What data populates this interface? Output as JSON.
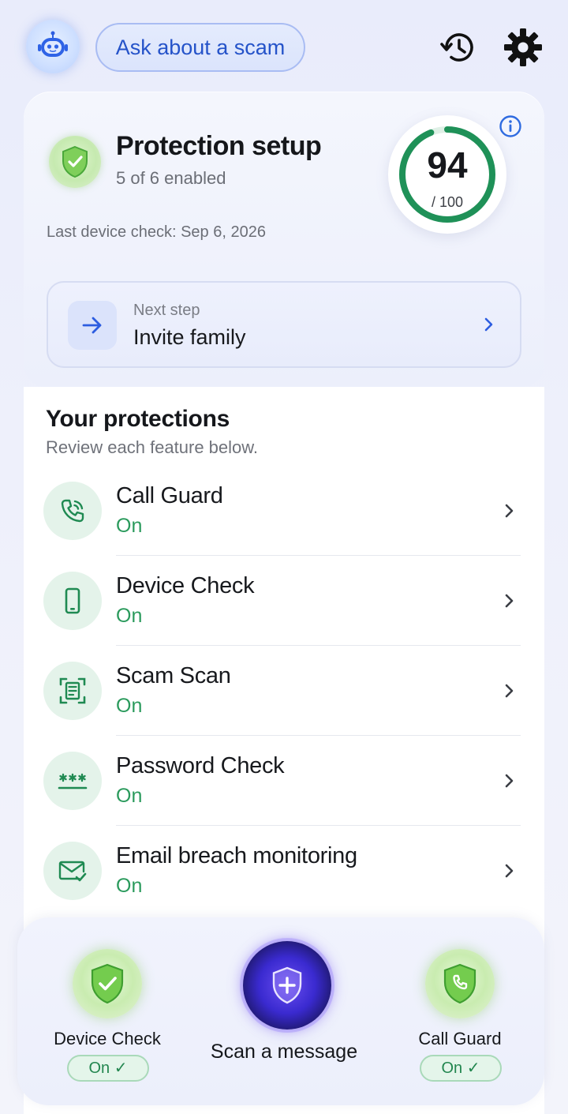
{
  "topbar": {
    "ask_label": "Ask about a scam",
    "avatar_icon": "assistant-bot-icon",
    "history_icon": "history-icon",
    "settings_icon": "gear-icon"
  },
  "setup": {
    "title": "Protection setup",
    "subtitle": "5 of 6 enabled",
    "last_check": "Last device check: Sep 6, 2026",
    "score": "94",
    "score_max": "/ 100",
    "score_fraction": 0.94,
    "next_step_label": "Next step",
    "next_step_value": "Invite family"
  },
  "protections": {
    "title": "Your protections",
    "subtitle": "Review each feature below.",
    "items": [
      {
        "name": "Call Guard",
        "status": "On",
        "icon": "phone-call-icon"
      },
      {
        "name": "Device Check",
        "status": "On",
        "icon": "smartphone-icon"
      },
      {
        "name": "Scam Scan",
        "status": "On",
        "icon": "scan-document-icon"
      },
      {
        "name": "Password Check",
        "status": "On",
        "icon": "password-icon"
      },
      {
        "name": "Email breach monitoring",
        "status": "On",
        "icon": "mail-check-icon"
      }
    ]
  },
  "dock": {
    "left_label": "Device Check",
    "left_status": "On ✓",
    "center_label": "Scan a message",
    "right_label": "Call Guard",
    "right_status": "On ✓"
  },
  "colors": {
    "accent_blue": "#2553c9",
    "status_green": "#2a9a5c",
    "ring_green": "#1f9158"
  }
}
